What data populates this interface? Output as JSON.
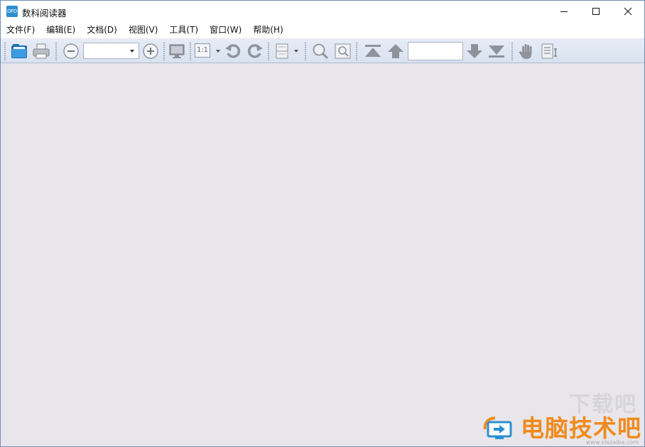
{
  "window": {
    "title": "数科阅读器",
    "app_icon_text": "OFD"
  },
  "menu": [
    {
      "label": "文件(F)",
      "name": "menu-file"
    },
    {
      "label": "编辑(E)",
      "name": "menu-edit"
    },
    {
      "label": "文档(D)",
      "name": "menu-document"
    },
    {
      "label": "视图(V)",
      "name": "menu-view"
    },
    {
      "label": "工具(T)",
      "name": "menu-tools"
    },
    {
      "label": "窗口(W)",
      "name": "menu-window"
    },
    {
      "label": "帮助(H)",
      "name": "menu-help"
    }
  ],
  "toolbar": {
    "zoom_value": "",
    "ratio_label": "1:1",
    "page_value": ""
  },
  "watermark": {
    "text": "电脑技术吧",
    "faded_text": "下载吧",
    "url": "www.xiazaiba.com"
  },
  "colors": {
    "toolbar_bg": "#dfe6f2",
    "workspace_bg": "#e8e6ea",
    "watermark": "#f08a1c",
    "icon_blue": "#2b8fd0"
  }
}
